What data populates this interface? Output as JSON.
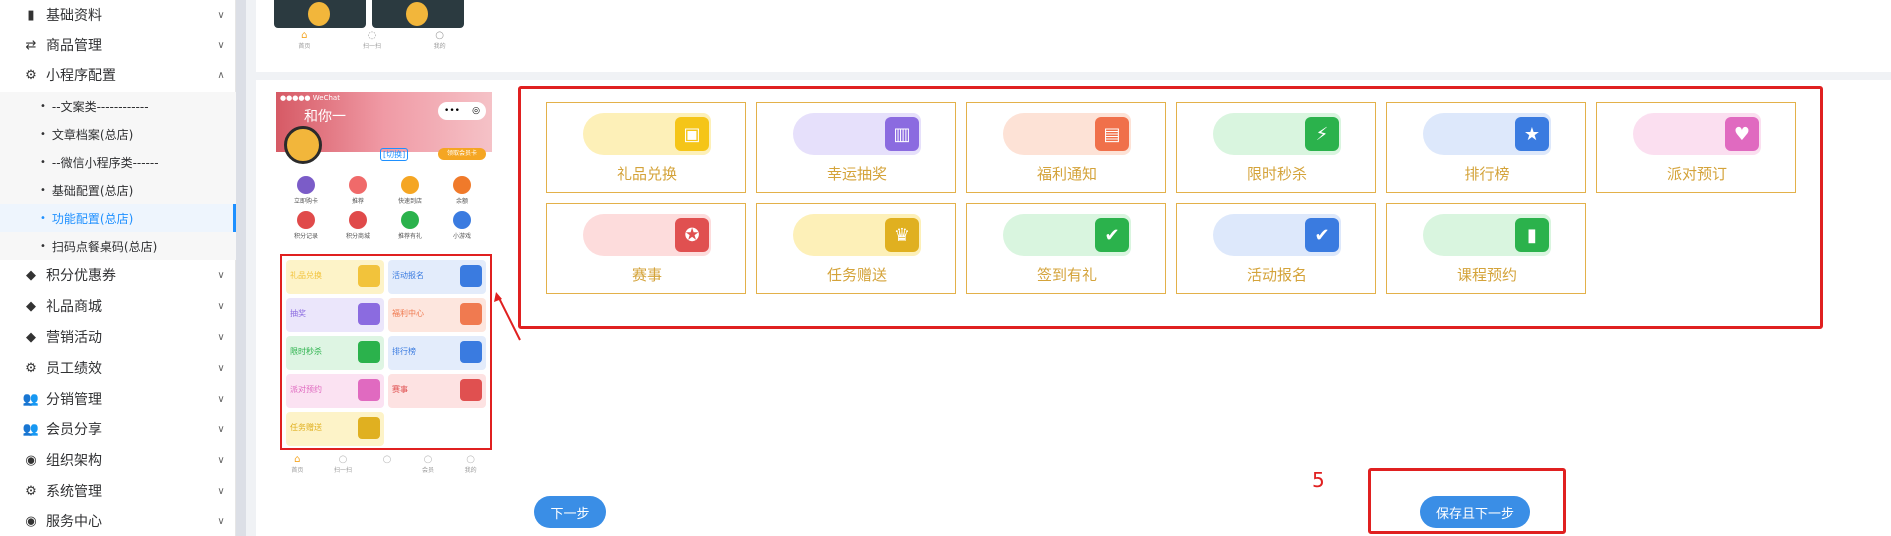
{
  "sidebar": {
    "items": [
      {
        "label": "基础资料",
        "icon": "document-icon"
      },
      {
        "label": "商品管理",
        "icon": "exchange-icon"
      },
      {
        "label": "小程序配置",
        "icon": "gear-icon"
      },
      {
        "label": "积分优惠券",
        "icon": "tag-icon"
      },
      {
        "label": "礼品商城",
        "icon": "tag-icon"
      },
      {
        "label": "营销活动",
        "icon": "tag-icon"
      },
      {
        "label": "员工绩效",
        "icon": "gear-icon"
      },
      {
        "label": "分销管理",
        "icon": "users-icon"
      },
      {
        "label": "会员分享",
        "icon": "users-icon"
      },
      {
        "label": "组织架构",
        "icon": "target-icon"
      },
      {
        "label": "系统管理",
        "icon": "gear-icon"
      },
      {
        "label": "服务中心",
        "icon": "target-icon"
      }
    ],
    "subitems": [
      {
        "label": "--文案类------------"
      },
      {
        "label": "文章档案(总店)"
      },
      {
        "label": "--微信小程序类------"
      },
      {
        "label": "基础配置(总店)"
      },
      {
        "label": "功能配置(总店)"
      },
      {
        "label": "扫码点餐桌码(总店)"
      }
    ]
  },
  "phone": {
    "status": "●●●●● WeChat",
    "greeting": "和你一",
    "nick_tag": "[切换]",
    "member_button": "领取会员卡",
    "grid": [
      {
        "label": "立即购卡",
        "color": "#7b5cc8"
      },
      {
        "label": "推荐",
        "color": "#f06a6a"
      },
      {
        "label": "快速到店",
        "color": "#f5a623"
      },
      {
        "label": "余额",
        "color": "#f07a2a"
      },
      {
        "label": "积分记录",
        "color": "#e04a4a"
      },
      {
        "label": "积分商城",
        "color": "#e04a4a"
      },
      {
        "label": "推荐有礼",
        "color": "#2bb24c"
      },
      {
        "label": "小游戏",
        "color": "#3a7be0"
      }
    ],
    "cards": [
      {
        "label": "礼品兑换",
        "bg": "#fdf3c8",
        "color": "#f2c33b"
      },
      {
        "label": "活动报名",
        "bg": "#e3ecfb",
        "color": "#3a7be0"
      },
      {
        "label": "抽奖",
        "bg": "#ebe6fb",
        "color": "#8b6be0"
      },
      {
        "label": "福利中心",
        "bg": "#fde6de",
        "color": "#f07a50"
      },
      {
        "label": "限时秒杀",
        "bg": "#def5e3",
        "color": "#2bb24c"
      },
      {
        "label": "排行榜",
        "bg": "#e3ecfb",
        "color": "#3a7be0"
      },
      {
        "label": "派对预约",
        "bg": "#fbe2f2",
        "color": "#e06ac0"
      },
      {
        "label": "赛事",
        "bg": "#fde2e2",
        "color": "#e05050"
      },
      {
        "label": "任务赠送",
        "bg": "#fdf3c8",
        "color": "#e0b020"
      }
    ],
    "tabs": [
      "首页",
      "扫一扫",
      "",
      "会员",
      "我的"
    ]
  },
  "top_tabs": [
    "首页",
    "扫一扫",
    "我的"
  ],
  "features": [
    {
      "label": "礼品兑换",
      "bg": "#fdf0b8",
      "color": "#f5c518",
      "glyph": "▣"
    },
    {
      "label": "幸运抽奖",
      "bg": "#e6e0fb",
      "color": "#8b6be0",
      "glyph": "▥"
    },
    {
      "label": "福利通知",
      "bg": "#fde2d6",
      "color": "#f0704a",
      "glyph": "▤"
    },
    {
      "label": "限时秒杀",
      "bg": "#d9f5df",
      "color": "#2bb24c",
      "glyph": "⚡"
    },
    {
      "label": "排行榜",
      "bg": "#dde8fb",
      "color": "#3a7be0",
      "glyph": "★"
    },
    {
      "label": "派对预订",
      "bg": "#fbdff0",
      "color": "#e06ac0",
      "glyph": "♥"
    },
    {
      "label": "赛事",
      "bg": "#fddcdc",
      "color": "#e05050",
      "glyph": "✪"
    },
    {
      "label": "任务赠送",
      "bg": "#fdf0b8",
      "color": "#e0b020",
      "glyph": "♛"
    },
    {
      "label": "签到有礼",
      "bg": "#d9f5df",
      "color": "#2bb24c",
      "glyph": "✔"
    },
    {
      "label": "活动报名",
      "bg": "#dde8fb",
      "color": "#3a7be0",
      "glyph": "✔"
    },
    {
      "label": "课程预约",
      "bg": "#d9f5df",
      "color": "#2bb24c",
      "glyph": "▮"
    }
  ],
  "step_number": "5",
  "buttons": {
    "next": "下一步",
    "save_next": "保存且下一步"
  }
}
